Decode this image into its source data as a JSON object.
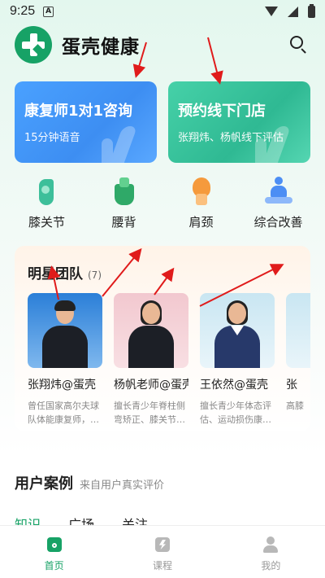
{
  "status": {
    "time": "9:25",
    "notif_icon": "A"
  },
  "header": {
    "title": "蛋壳健康",
    "logo_icon": "cross-logo-icon",
    "search_icon": "search-icon"
  },
  "cards": [
    {
      "title": "康复师1对1咨询",
      "subtitle": "15分钟语音",
      "color": "#3d8ef2"
    },
    {
      "title": "预约线下门店",
      "subtitle": "张翔炜、杨帆线下评估",
      "color": "#2fb993"
    }
  ],
  "categories": [
    {
      "label": "膝关节",
      "icon": "knee-icon"
    },
    {
      "label": "腰背",
      "icon": "waist-icon"
    },
    {
      "label": "肩颈",
      "icon": "neck-icon"
    },
    {
      "label": "综合改善",
      "icon": "meditation-icon"
    }
  ],
  "team": {
    "title": "明星团队",
    "count": "(7)",
    "members": [
      {
        "name": "张翔炜@蛋壳",
        "desc": "曾任国家高尔夫球队体能康复师，…",
        "tag": ""
      },
      {
        "name": "杨帆老师@蛋壳",
        "desc": "擅长青少年脊柱侧弯矫正、膝关节…",
        "tag": ""
      },
      {
        "name": "王依然@蛋壳",
        "desc": "擅长青少年体态评估、运动损伤康…",
        "tag": ""
      },
      {
        "name": "张",
        "desc": "高膝",
        "tag": ""
      }
    ]
  },
  "cases": {
    "title": "用户案例",
    "subtitle": "来自用户真实评价"
  },
  "subtabs": [
    "知识",
    "广场",
    "关注"
  ],
  "nav": [
    {
      "label": "首页",
      "icon": "home-icon",
      "active": true
    },
    {
      "label": "课程",
      "icon": "course-icon",
      "active": false
    },
    {
      "label": "我的",
      "icon": "profile-icon",
      "active": false
    }
  ],
  "colors": {
    "brand": "#17a266",
    "annotation": "#e01b1b"
  }
}
